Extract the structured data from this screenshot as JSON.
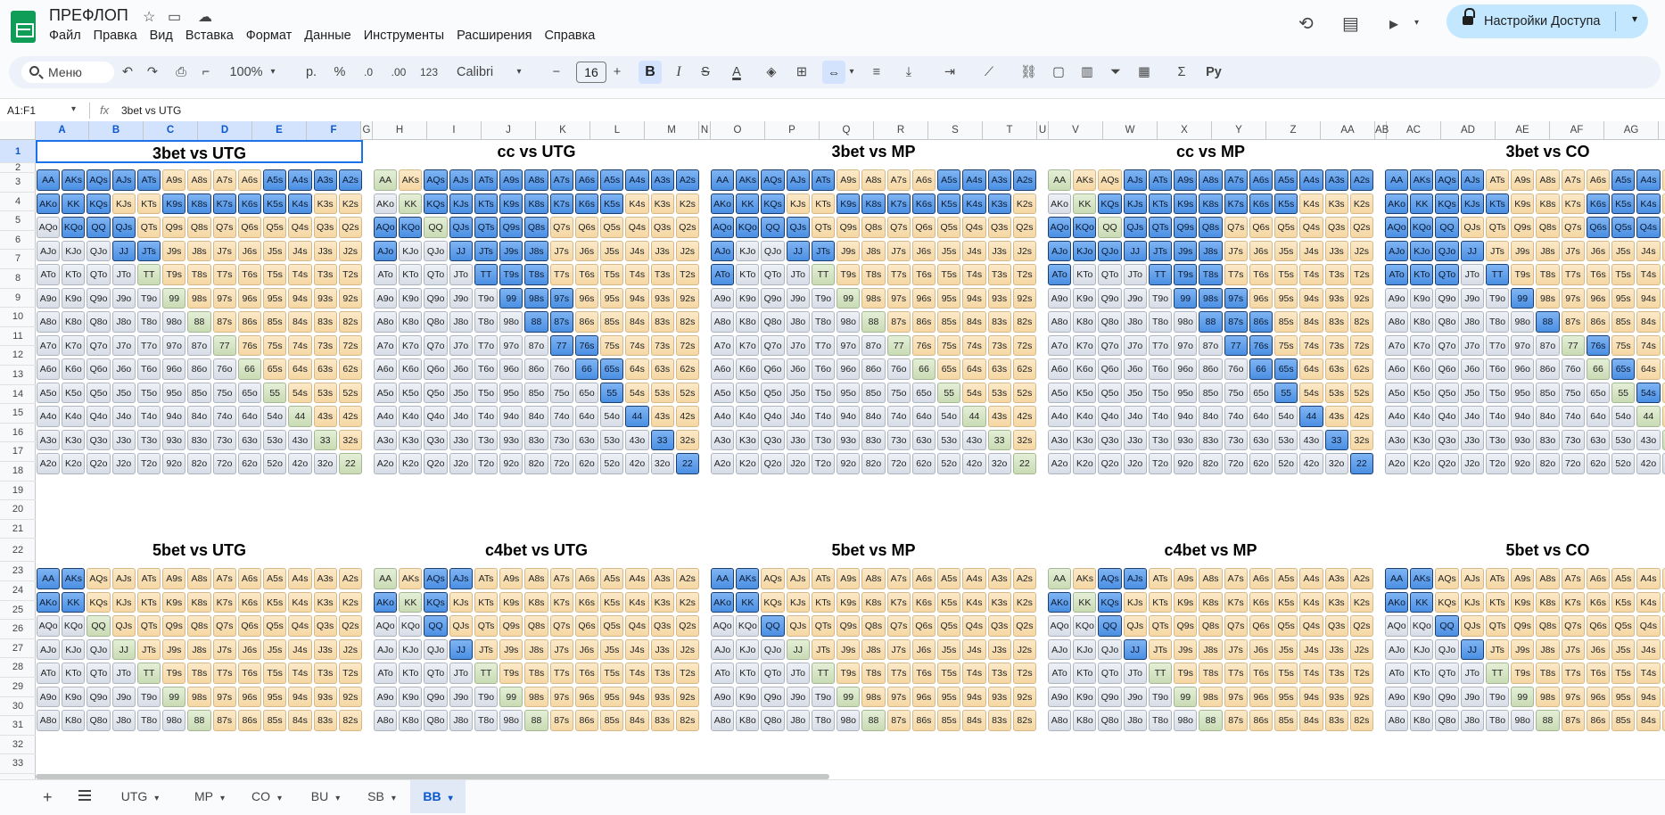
{
  "app": {
    "title": "ПРЕФЛОП",
    "menu": [
      "Файл",
      "Правка",
      "Вид",
      "Вставка",
      "Формат",
      "Данные",
      "Инструменты",
      "Расширения",
      "Справка"
    ],
    "share_label": "Настройки Доступа",
    "icons": [
      "star-icon",
      "folder-move-icon",
      "cloud-status-icon",
      "history-icon",
      "comments-icon",
      "meet-icon",
      "lock-icon"
    ]
  },
  "toolbar": {
    "search": "Меню",
    "zoom": "100%",
    "currency": "р.",
    "percent": "%",
    "dec_less": ".0",
    "dec_more": ".00",
    "number_format": "123",
    "font": "Calibri",
    "font_size": "16",
    "bold": "B",
    "italic": "I",
    "strike": "S",
    "text_color": "A"
  },
  "formula": {
    "namebox": "A1:F1",
    "fx": "fx",
    "content": "3bet vs UTG"
  },
  "columns": [
    "A",
    "B",
    "C",
    "D",
    "E",
    "F",
    "G",
    "H",
    "I",
    "J",
    "K",
    "L",
    "M",
    "N",
    "O",
    "P",
    "Q",
    "R",
    "S",
    "T",
    "U",
    "V",
    "W",
    "X",
    "Y",
    "Z",
    "AA",
    "AB",
    "AC",
    "AD",
    "AE",
    "AF",
    "AG"
  ],
  "rows": [
    "1",
    "2",
    "3",
    "4",
    "5",
    "6",
    "7",
    "8",
    "9",
    "10",
    "11",
    "12",
    "13",
    "14",
    "15",
    "16",
    "17",
    "18",
    "19",
    "20",
    "21",
    "22",
    "23",
    "24",
    "25",
    "26",
    "27",
    "28",
    "29",
    "30",
    "31",
    "32",
    "33"
  ],
  "ranks": [
    "A",
    "K",
    "Q",
    "J",
    "T",
    "9",
    "8",
    "7",
    "6",
    "5",
    "4",
    "3",
    "2"
  ],
  "panels": [
    {
      "title": "3bet vs UTG",
      "hands": [
        "AA",
        "AKs",
        "AQs",
        "AJs",
        "ATs",
        "A5s",
        "A4s",
        "A3s",
        "A2s",
        "AKo",
        "KK",
        "KQs",
        "K9s",
        "K8s",
        "K7s",
        "K6s",
        "K5s",
        "K4s",
        "KQo",
        "QQ",
        "QJs",
        "JJ",
        "JTs"
      ]
    },
    {
      "title": "cc vs UTG",
      "hands": [
        "AQs",
        "AJs",
        "ATs",
        "A9s",
        "A8s",
        "A7s",
        "A6s",
        "A5s",
        "A4s",
        "A3s",
        "A2s",
        "KQs",
        "KJs",
        "KTs",
        "K9s",
        "K8s",
        "K7s",
        "K6s",
        "K5s",
        "AQo",
        "KQo",
        "QJs",
        "QTs",
        "Q9s",
        "Q8s",
        "AJo",
        "JJ",
        "JTs",
        "J9s",
        "J8s",
        "TT",
        "T9s",
        "T8s",
        "99",
        "98s",
        "97s",
        "88",
        "87s",
        "77",
        "76s",
        "66",
        "65s",
        "55",
        "44",
        "33",
        "22"
      ]
    },
    {
      "title": "3bet vs MP",
      "hands": [
        "AA",
        "AKs",
        "AQs",
        "AJs",
        "ATs",
        "A5s",
        "A4s",
        "A3s",
        "A2s",
        "AKo",
        "KK",
        "KQs",
        "K9s",
        "K8s",
        "K7s",
        "K6s",
        "K5s",
        "K4s",
        "K3s",
        "AQo",
        "KQo",
        "QQ",
        "QJs",
        "AJo",
        "JJ",
        "JTs",
        "ATo"
      ]
    },
    {
      "title": "cc vs MP",
      "hands": [
        "AJs",
        "ATs",
        "A9s",
        "A8s",
        "A7s",
        "A6s",
        "A5s",
        "A4s",
        "A3s",
        "A2s",
        "KQs",
        "KJs",
        "KTs",
        "K9s",
        "K8s",
        "K7s",
        "K6s",
        "K5s",
        "AQo",
        "KQo",
        "QJs",
        "QTs",
        "Q9s",
        "Q8s",
        "AJo",
        "KJo",
        "QJo",
        "JJ",
        "JTs",
        "J9s",
        "J8s",
        "ATo",
        "TT",
        "T9s",
        "T8s",
        "99",
        "98s",
        "97s",
        "88",
        "87s",
        "86s",
        "77",
        "76s",
        "66",
        "65s",
        "55",
        "44",
        "33",
        "22"
      ]
    },
    {
      "title": "3bet vs CO",
      "hands": [
        "AA",
        "AKs",
        "AQs",
        "AJs",
        "A5s",
        "A4s",
        "AKo",
        "KK",
        "KQs",
        "KJs",
        "KTs",
        "K6s",
        "K5s",
        "K4s",
        "AQo",
        "KQo",
        "QQ",
        "Q6s",
        "Q5s",
        "Q4s",
        "AJo",
        "KJo",
        "QJo",
        "JJ",
        "ATo",
        "KTo",
        "QTo",
        "TT",
        "99",
        "88",
        "76s",
        "65s",
        "54s"
      ]
    },
    {
      "title": "5bet vs UTG",
      "hands": [
        "AA",
        "AKs",
        "AKo",
        "KK"
      ]
    },
    {
      "title": "c4bet vs UTG",
      "hands": [
        "AQs",
        "AJs",
        "AKo",
        "KQs",
        "QQ",
        "JJ"
      ]
    },
    {
      "title": "5bet vs MP",
      "hands": [
        "AA",
        "AKs",
        "AKo",
        "KK",
        "QQ"
      ]
    },
    {
      "title": "c4bet vs MP",
      "hands": [
        "AQs",
        "AJs",
        "AKo",
        "KQs",
        "QQ",
        "JJ"
      ]
    },
    {
      "title": "5bet vs CO",
      "hands": [
        "AA",
        "AKs",
        "AKo",
        "KK",
        "QQ",
        "JJ"
      ]
    }
  ],
  "sheets": [
    "UTG",
    "MP",
    "CO",
    "BU",
    "SB",
    "BB"
  ],
  "active_sheet": "BB",
  "colors": {
    "raise": "#4a8fe3",
    "suited_fold": "#f5d7a3",
    "offsuit_fold": "#d7dde7",
    "pair_fold": "#c9dbb4",
    "accent": "#0b57d0"
  }
}
